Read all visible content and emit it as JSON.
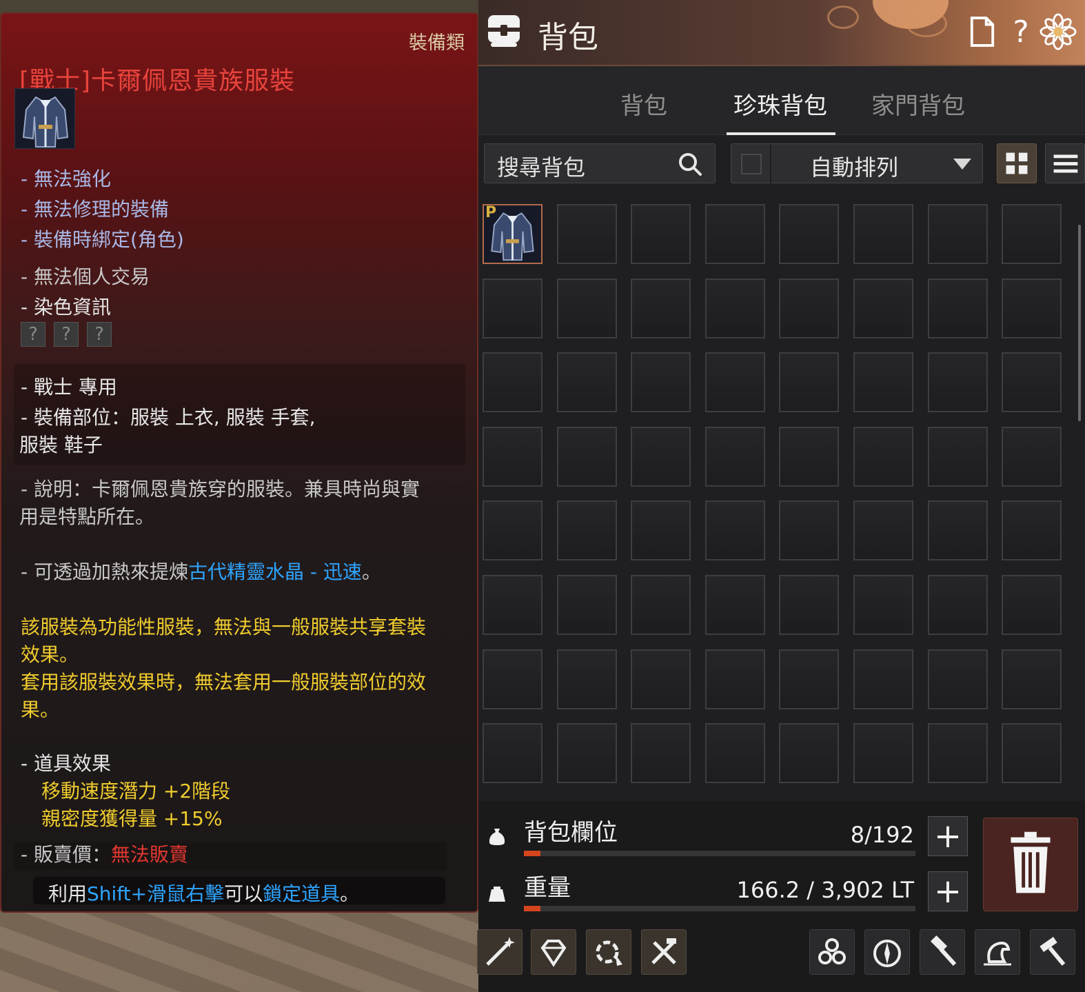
{
  "tooltip": {
    "category": "裝備類",
    "title": "[戰士]卡爾佩恩貴族服裝",
    "flags": [
      "- 無法強化",
      "- 無法修理的裝備",
      "- 裝備時綁定(角色)"
    ],
    "trade": "- 無法個人交易",
    "dye_label": "- 染色資訊",
    "dye_slots": [
      "?",
      "?",
      "?"
    ],
    "class_only": "- 戰士 專用",
    "slots_line1": "- 裝備部位：服裝 上衣, 服裝 手套,",
    "slots_line2": "服裝 鞋子",
    "desc_line1": "- 說明：卡爾佩恩貴族穿的服裝。兼具時尚與實",
    "desc_line2": "用是特點所在。",
    "refine_prefix": "- 可透過加熱來提煉",
    "refine_item": "古代精靈水晶 - 迅速",
    "refine_suffix": "。",
    "note_line1": "該服裝為功能性服裝，無法與一般服裝共享套裝",
    "note_line2": "效果。",
    "note_line3": "套用該服裝效果時，無法套用一般服裝部位的效",
    "note_line4": "果。",
    "effect_label": "- 道具效果",
    "effect1": "移動速度潛力 +2階段",
    "effect2": "親密度獲得量 +15%",
    "sell_label": "- 販賣價：",
    "sell_value": "無法販賣",
    "hint_prefix": "利用",
    "hint_key": "Shift+滑鼠右擊",
    "hint_mid": "可以",
    "hint_action": "鎖定道具",
    "hint_suffix": "。"
  },
  "inventory": {
    "title": "背包",
    "tabs": [
      "背包",
      "珍珠背包",
      "家門背包"
    ],
    "active_tab": "珍珠背包",
    "search_placeholder": "搜尋背包",
    "sort_label": "自動排列",
    "slot_badge": "P",
    "slot_count_label": "背包欄位",
    "slot_count_value": "8/192",
    "slot_fill_fraction": 0.042,
    "weight_label": "重量",
    "weight_value": "166.2 / 3,902 LT",
    "weight_fill_fraction": 0.043,
    "plus": "+",
    "header_icons": [
      "document-icon",
      "help-icon",
      "settings-flower-icon"
    ],
    "tools": [
      "enhance-icon",
      "gem-icon",
      "extract-icon",
      "repair-icon",
      "swirl-icon",
      "compass-icon",
      "hammer-icon",
      "dragon-icon",
      "build-hammer-icon"
    ]
  },
  "colors": {
    "title_red": "#e8443c",
    "flag_blue": "#a9b8e6",
    "note_gold": "#f0cc2e",
    "link_cyan": "#2ea4ff",
    "bar_red": "#d4451e"
  }
}
